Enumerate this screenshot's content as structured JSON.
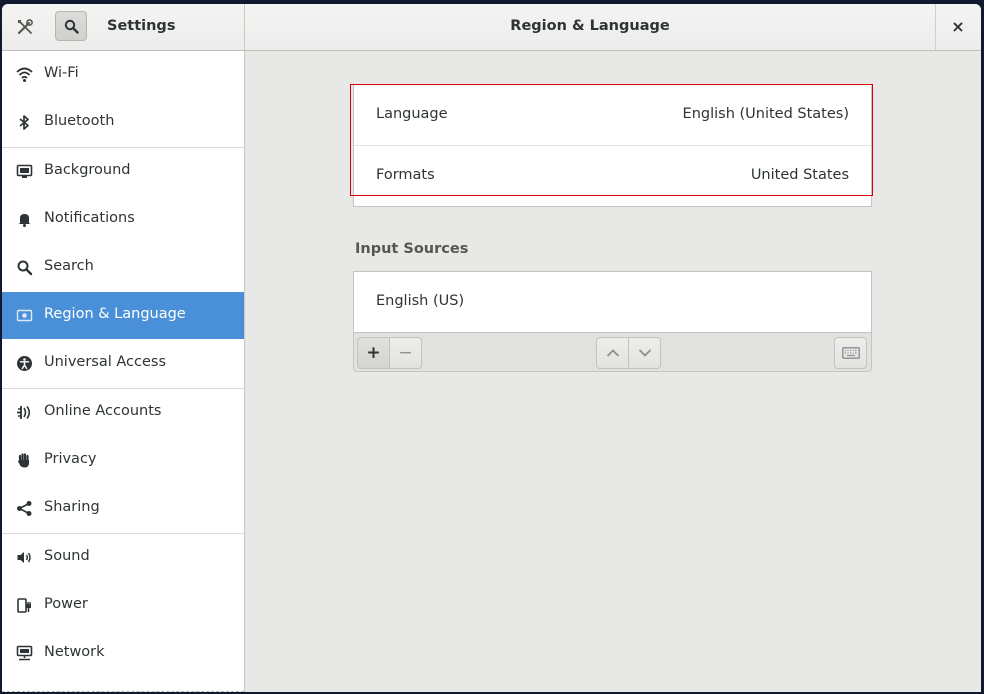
{
  "header": {
    "app_title": "Settings",
    "page_title": "Region & Language",
    "close_glyph": "×"
  },
  "sidebar": {
    "items": [
      {
        "label": "Wi-Fi",
        "icon": "wifi-icon"
      },
      {
        "label": "Bluetooth",
        "icon": "bluetooth-icon"
      },
      {
        "label": "Background",
        "icon": "background-icon"
      },
      {
        "label": "Notifications",
        "icon": "bell-icon"
      },
      {
        "label": "Search",
        "icon": "search-icon"
      },
      {
        "label": "Region & Language",
        "icon": "flag-icon",
        "selected": true
      },
      {
        "label": "Universal Access",
        "icon": "accessibility-icon"
      },
      {
        "label": "Online Accounts",
        "icon": "online-accounts-icon"
      },
      {
        "label": "Privacy",
        "icon": "hand-icon"
      },
      {
        "label": "Sharing",
        "icon": "share-icon"
      },
      {
        "label": "Sound",
        "icon": "speaker-icon"
      },
      {
        "label": "Power",
        "icon": "power-plug-icon"
      },
      {
        "label": "Network",
        "icon": "network-icon"
      }
    ]
  },
  "language_panel": {
    "language_label": "Language",
    "language_value": "English (United States)",
    "formats_label": "Formats",
    "formats_value": "United States"
  },
  "input_sources": {
    "title": "Input Sources",
    "sources": [
      "English (US)"
    ],
    "add_glyph": "+",
    "remove_glyph": "−"
  },
  "colors": {
    "accent": "#4a90d9",
    "highlight_border": "#d9000d"
  }
}
